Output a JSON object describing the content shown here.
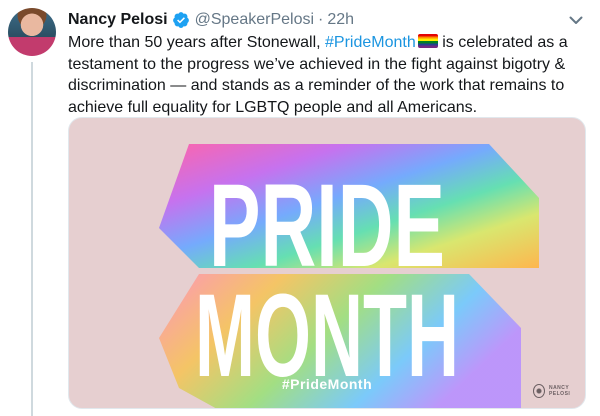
{
  "tweet": {
    "author_name": "Nancy Pelosi",
    "handle": "@SpeakerPelosi",
    "separator": "·",
    "time": "22h",
    "text_before": "More than 50 years after Stonewall, ",
    "hashtag": "#PrideMonth",
    "text_after": " is celebrated as a testament to the progress we’ve achieved in the fight against bigotry & discrimination — and stands as a reminder of the work that remains to achieve full equality for LGBTQ people and all Americans."
  },
  "media": {
    "line1": "PRIDE",
    "line2": "MONTH",
    "hashtag": "#PrideMonth",
    "seal_label": "NANCY PELOSI"
  },
  "colors": {
    "link": "#1b95e0",
    "verified": "#1da1f2",
    "card_background": "#e6cfd0"
  },
  "icons": [
    "verified-badge-icon",
    "chevron-down-icon",
    "rainbow-flag-icon"
  ]
}
